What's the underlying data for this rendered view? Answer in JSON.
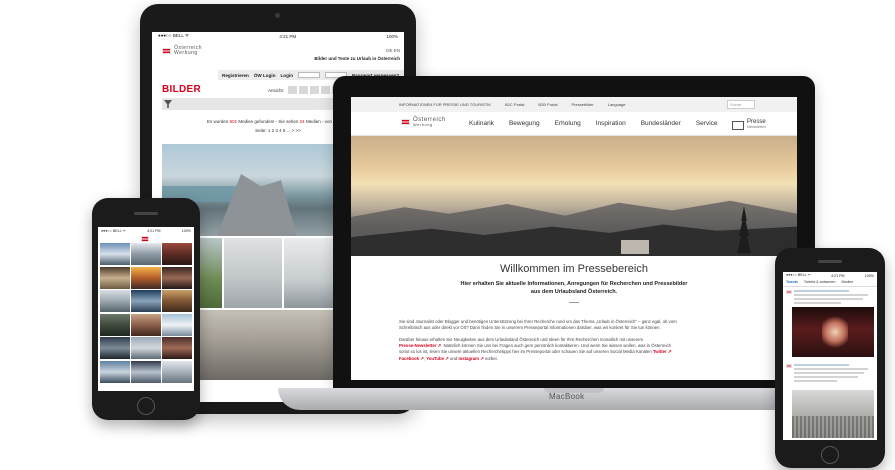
{
  "brand": {
    "line1": "Österreich",
    "line2": "Werbung"
  },
  "tablet": {
    "status": {
      "carrier": "●●●○○ BELL ᯤ",
      "time": "4:21 PM",
      "battery": "100%"
    },
    "header_link": "Bilder und Texte zu Urlaub in Österreich",
    "lang": "DE EN",
    "nav": {
      "register": "Registrieren",
      "ow_login": "ÖW Login",
      "login": "Login",
      "passwort_label": "Passwort vergessen?"
    },
    "section_title": "BILDER",
    "ansicht_label": "Ansicht:",
    "results_prefix": "Es wurden",
    "results_count": "601",
    "results_mid": "Medien gefunden! - Sie sehen",
    "results_shown": "24",
    "results_suffix": "Medien - von 1 bis 24",
    "pager": "Seite: 1  2  3  4  5 ... >  >>"
  },
  "laptop": {
    "topbar": {
      "label": "INFORMATIONEN FÜR PRESSE UND TOURISTIK",
      "item1": "B2C Portal",
      "item2": "B2B Portal",
      "item3": "Pressebilder",
      "item4": "Language",
      "search_placeholder": "Suche"
    },
    "nav": [
      "Kulinarik",
      "Bewegung",
      "Erholung",
      "Inspiration",
      "Bundesländer",
      "Service"
    ],
    "presse": {
      "label": "Presse",
      "sub": "Newsletter"
    },
    "title": "Willkommen im Pressebereich",
    "subtitle_line1": "Hier erhalten Sie aktuelle Informationen, Anregungen für Recherchen und Pressebilder",
    "subtitle_line2": "aus dem Urlaubsland Österreich.",
    "para1_line1": "Sie sind Journalist oder Blogger und benötigen Unterstützung bei Ihrer Recherche rund um das Thema „Urlaub in Österreich“ – ganz egal, ob vom",
    "para1_line2": "Schreibtisch aus oder direkt vor Ort? Dann finden Sie in unserem Presseportal Informationen darüber, was wir konkret für Sie tun können.",
    "para2_line1": "Darüber hinaus erhalten Sie Neuigkeiten aus dem Urlaubsland Österreich und Ideen für Ihre Recherchen monatlich mit unserem",
    "para2_newsletter": "Presse-Newsletter ↗",
    "para2_line2_rest": ". Natürlich können Sie uns bei Fragen auch gern persönlich kontaktieren. Und wenn Sie wissen wollen, was in Österreich",
    "para2_line3": "sonst so los ist, lesen Sie unsere aktuellen Recherchetipps hier im Presseportal oder schauen Sie auf unseren Social Media Kanälen",
    "para2_twitter": "Twitter ↗",
    "para2_facebook": "Facebook ↗",
    "para2_youtube": "YouTube ↗",
    "para2_und": "und",
    "para2_instagram": "Instagram ↗",
    "para2_end": "vorbei.",
    "device_label": "MacBook"
  },
  "phone_left": {
    "status": {
      "carrier": "●●●○○ BELL ᯤ",
      "time": "4:21 PM",
      "battery": "100%"
    }
  },
  "phone_right": {
    "status": {
      "carrier": "●●●○○ BELL ᯤ",
      "time": "4:21 PM",
      "battery": "100%"
    },
    "tabs": [
      "Tweets",
      "Tweets & antworten",
      "Medien"
    ]
  },
  "colors": {
    "accent_red": "#d6001c",
    "twitter_blue": "#1d6fb8"
  }
}
